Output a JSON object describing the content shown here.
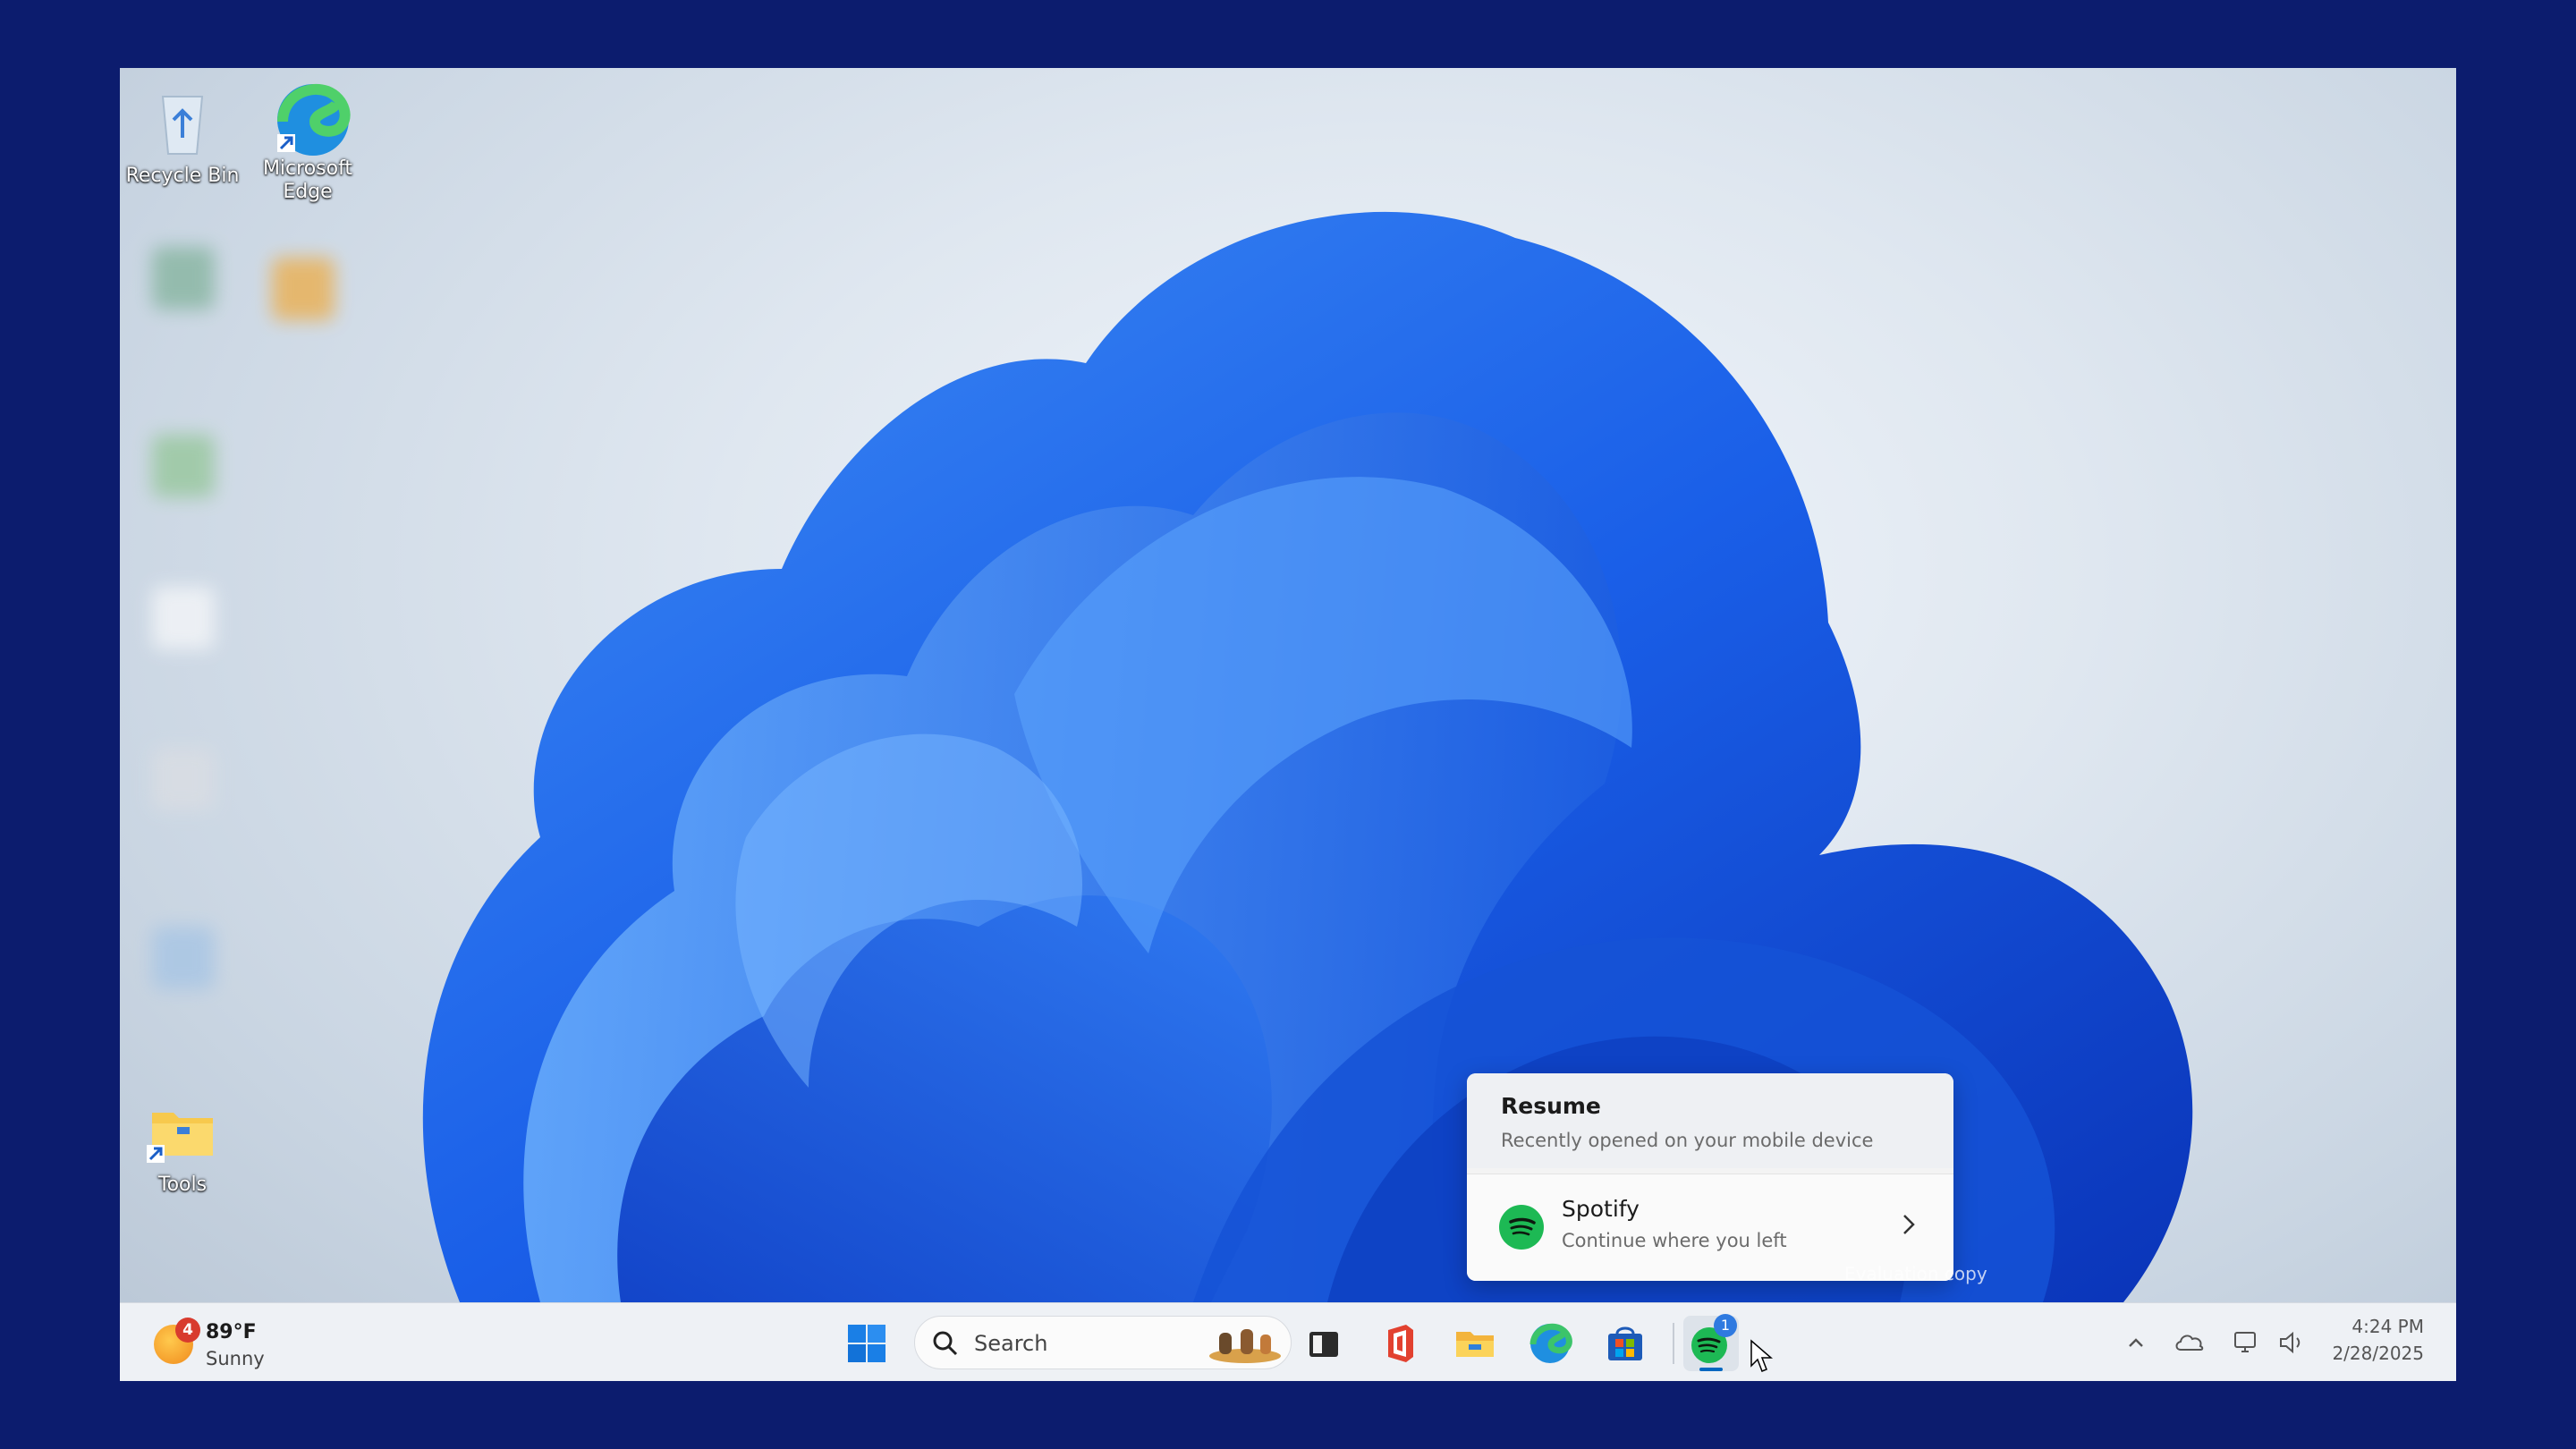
{
  "desktop": {
    "icons": [
      {
        "label": "Recycle Bin"
      },
      {
        "label": "Microsoft Edge"
      },
      {
        "label": "Tools"
      }
    ]
  },
  "flyout": {
    "title": "Resume",
    "subtitle": "Recently opened on your mobile device",
    "item": {
      "name": "Spotify",
      "description": "Continue where you left"
    }
  },
  "watermark": "Evaluation copy",
  "taskbar": {
    "weather": {
      "badge": "4",
      "temp": "89°F",
      "condition": "Sunny"
    },
    "search_placeholder": "Search",
    "spotify_badge": "1",
    "clock": {
      "time": "4:24 PM",
      "date": "2/28/2025"
    }
  },
  "colors": {
    "accent": "#0067c0",
    "spotify": "#1db954",
    "frame": "#0c1c6e"
  }
}
